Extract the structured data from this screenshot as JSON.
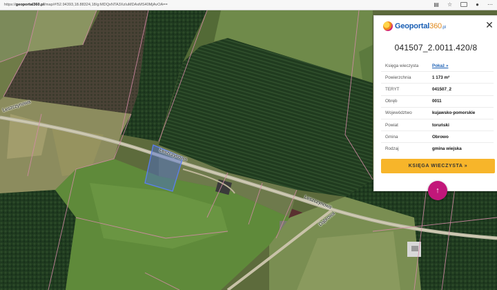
{
  "browser": {
    "url_prefix": "https://",
    "url_host": "geoportal360.pl",
    "url_rest": "/map/#!52.94393,18.88324,18/g:MDQxNTA3XzIuMDAxMS40MjAvOA==",
    "icons": [
      "reader-view-icon",
      "star-icon",
      "extensions-icon",
      "profile-icon",
      "menu-icon"
    ]
  },
  "map": {
    "road_labels": [
      "Leszczynowa",
      "Leszczynowa",
      "Leszczynowa",
      "Dąbrowa"
    ]
  },
  "panel": {
    "logo_text": "Geoportal",
    "logo_num": "360",
    "logo_suffix": ".pl",
    "close_symbol": "✕",
    "parcel_id": "041507_2.0011.420/8",
    "rows": [
      {
        "label": "Księga wieczysta",
        "value": "Pokaż »"
      },
      {
        "label": "Powierzchnia",
        "value": "1 173 m²"
      },
      {
        "label": "TERYT",
        "value": "041507_2"
      },
      {
        "label": "Obręb",
        "value": "0011"
      },
      {
        "label": "Województwo",
        "value": "kujawsko-pomorskie"
      },
      {
        "label": "Powiat",
        "value": "toruński"
      },
      {
        "label": "Gmina",
        "value": "Obrowo"
      },
      {
        "label": "Rodzaj",
        "value": "gmina wiejska"
      }
    ],
    "button_label": "KSIĘGA WIECZYSTA »"
  },
  "fab": {
    "symbol": "↑"
  },
  "colors": {
    "accent_yellow": "#f7b52a",
    "accent_magenta": "#c2177a",
    "link_blue": "#1a5fb4",
    "parcel_highlight": "#4b6fd6"
  }
}
